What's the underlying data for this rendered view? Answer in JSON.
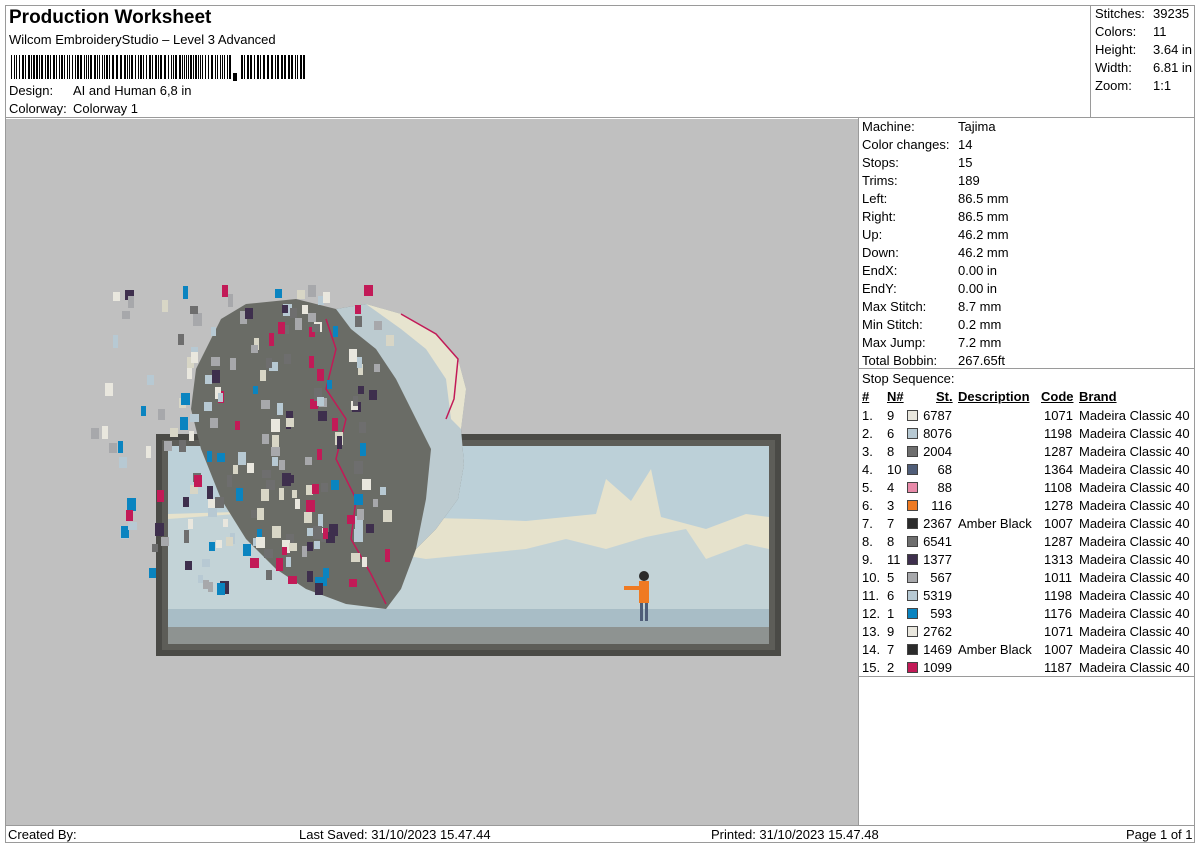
{
  "header": {
    "title": "Production Worksheet",
    "software": "Wilcom EmbroideryStudio – Level 3 Advanced",
    "design_label": "Design:",
    "design_value": "AI and Human 6,8 in",
    "colorway_label": "Colorway:",
    "colorway_value": "Colorway 1"
  },
  "summary": [
    {
      "label": "Stitches:",
      "value": "39235"
    },
    {
      "label": "Colors:",
      "value": "11"
    },
    {
      "label": "Height:",
      "value": "3.64 in"
    },
    {
      "label": "Width:",
      "value": "6.81 in"
    },
    {
      "label": "Zoom:",
      "value": "1:1"
    }
  ],
  "machine_info": [
    {
      "label": "Machine:",
      "value": "Tajima"
    },
    {
      "label": "Color changes:",
      "value": "14"
    },
    {
      "label": "Stops:",
      "value": "15"
    },
    {
      "label": "Trims:",
      "value": "189"
    },
    {
      "label": "Left:",
      "value": "86.5 mm"
    },
    {
      "label": "Right:",
      "value": "86.5 mm"
    },
    {
      "label": "Up:",
      "value": "46.2 mm"
    },
    {
      "label": "Down:",
      "value": "46.2 mm"
    },
    {
      "label": "EndX:",
      "value": "0.00 in"
    },
    {
      "label": "EndY:",
      "value": "0.00 in"
    },
    {
      "label": "Max Stitch:",
      "value": "8.7 mm"
    },
    {
      "label": "Min Stitch:",
      "value": "0.2 mm"
    },
    {
      "label": "Max Jump:",
      "value": "7.2 mm"
    },
    {
      "label": "Total Bobbin:",
      "value": "267.65ft"
    }
  ],
  "stop_sequence": {
    "heading": "Stop Sequence:",
    "columns": [
      "#",
      "N#",
      "St.",
      "Description",
      "Code",
      "Brand"
    ],
    "rows": [
      {
        "idx": "1.",
        "n": "9",
        "color": "#e9e7de",
        "st": "6787",
        "desc": "",
        "code": "1071",
        "brand": "Madeira Classic 40"
      },
      {
        "idx": "2.",
        "n": "6",
        "color": "#b7c9d3",
        "st": "8076",
        "desc": "",
        "code": "1198",
        "brand": "Madeira Classic 40"
      },
      {
        "idx": "3.",
        "n": "8",
        "color": "#6e6e6e",
        "st": "2004",
        "desc": "",
        "code": "1287",
        "brand": "Madeira Classic 40"
      },
      {
        "idx": "4.",
        "n": "10",
        "color": "#4f5d78",
        "st": "68",
        "desc": "",
        "code": "1364",
        "brand": "Madeira Classic 40"
      },
      {
        "idx": "5.",
        "n": "4",
        "color": "#e88aa9",
        "st": "88",
        "desc": "",
        "code": "1108",
        "brand": "Madeira Classic 40"
      },
      {
        "idx": "6.",
        "n": "3",
        "color": "#ef7a22",
        "st": "116",
        "desc": "",
        "code": "1278",
        "brand": "Madeira Classic 40"
      },
      {
        "idx": "7.",
        "n": "7",
        "color": "#2b2b2b",
        "st": "2367",
        "desc": "Amber Black",
        "code": "1007",
        "brand": "Madeira Classic 40"
      },
      {
        "idx": "8.",
        "n": "8",
        "color": "#6e6e6e",
        "st": "6541",
        "desc": "",
        "code": "1287",
        "brand": "Madeira Classic 40"
      },
      {
        "idx": "9.",
        "n": "11",
        "color": "#3e2f4d",
        "st": "1377",
        "desc": "",
        "code": "1313",
        "brand": "Madeira Classic 40"
      },
      {
        "idx": "10.",
        "n": "5",
        "color": "#a7a8ab",
        "st": "567",
        "desc": "",
        "code": "1011",
        "brand": "Madeira Classic 40"
      },
      {
        "idx": "11.",
        "n": "6",
        "color": "#b7c9d3",
        "st": "5319",
        "desc": "",
        "code": "1198",
        "brand": "Madeira Classic 40"
      },
      {
        "idx": "12.",
        "n": "1",
        "color": "#0a84c0",
        "st": "593",
        "desc": "",
        "code": "1176",
        "brand": "Madeira Classic 40"
      },
      {
        "idx": "13.",
        "n": "9",
        "color": "#e9e7de",
        "st": "2762",
        "desc": "",
        "code": "1071",
        "brand": "Madeira Classic 40"
      },
      {
        "idx": "14.",
        "n": "7",
        "color": "#2b2b2b",
        "st": "1469",
        "desc": "Amber Black",
        "code": "1007",
        "brand": "Madeira Classic 40"
      },
      {
        "idx": "15.",
        "n": "2",
        "color": "#c21a57",
        "st": "1099",
        "desc": "",
        "code": "1187",
        "brand": "Madeira Classic 40"
      }
    ]
  },
  "footer": {
    "created_by": "Created By:",
    "last_saved": "Last Saved: 31/10/2023 15.47.44",
    "printed": "Printed: 31/10/2023 15.47.48",
    "page": "Page 1 of 1"
  }
}
